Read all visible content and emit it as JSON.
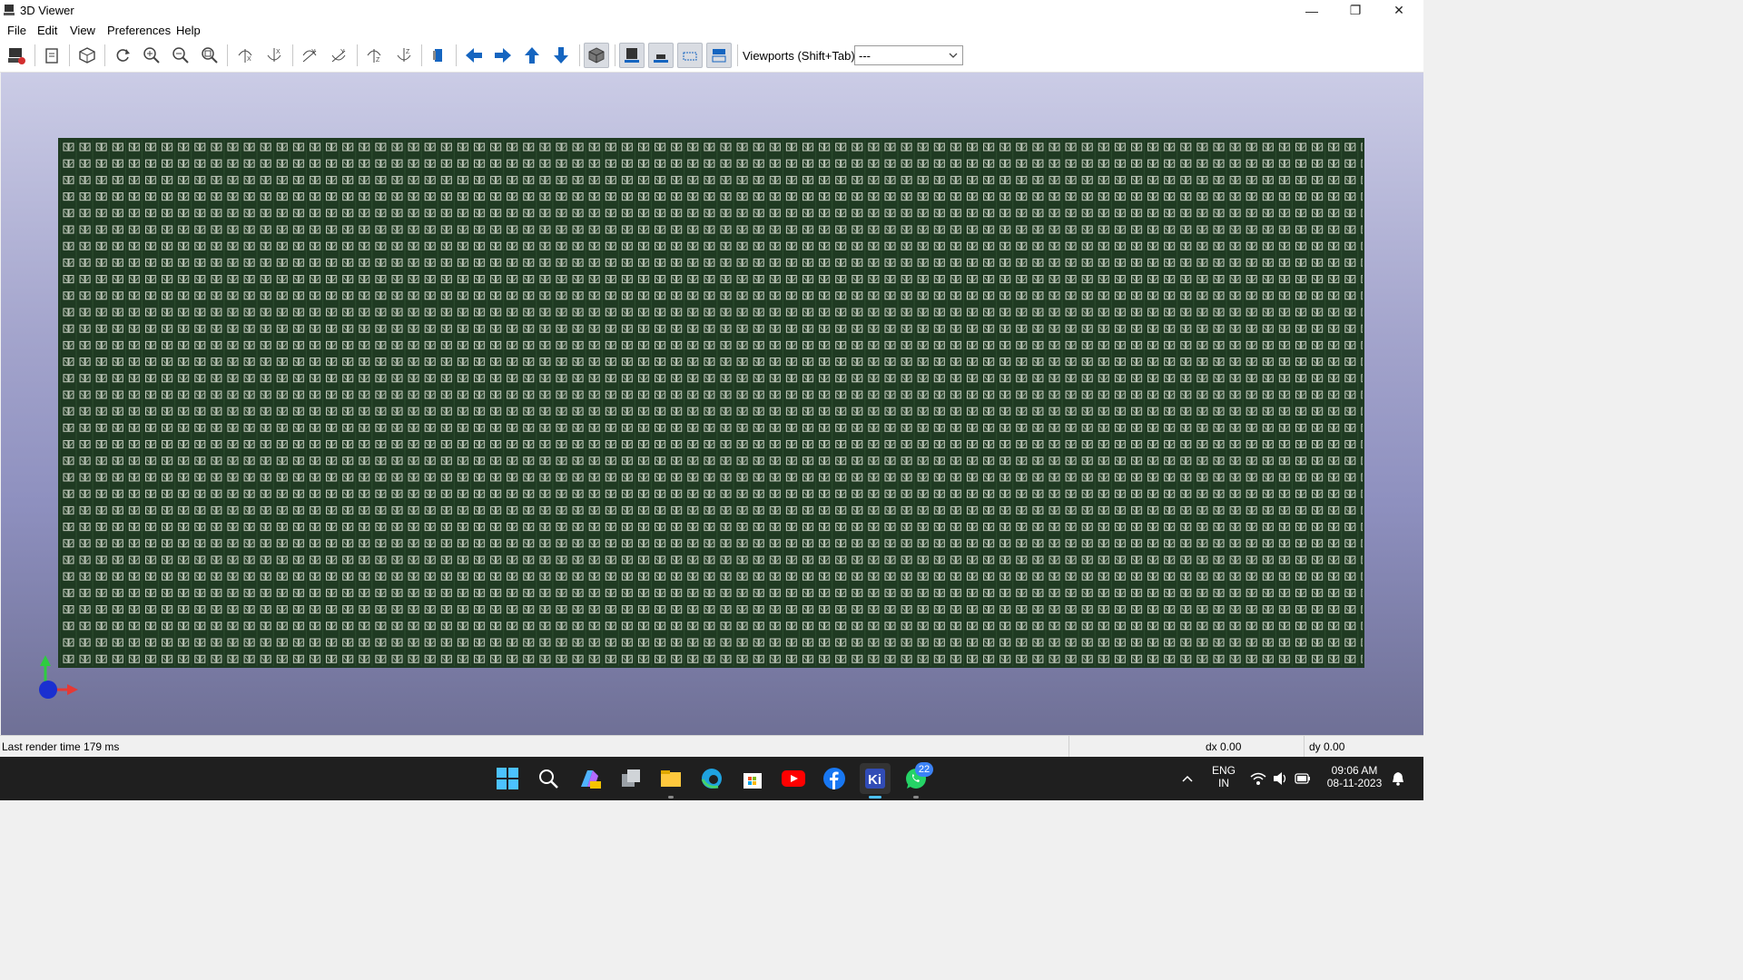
{
  "window": {
    "title": "3D Viewer",
    "minimize": "—",
    "restore": "❐",
    "close": "✕"
  },
  "menu": [
    "File",
    "Edit",
    "View",
    "Preferences",
    "Help"
  ],
  "toolbar": {
    "viewports_label": "Viewports (Shift+Tab):",
    "viewports_value": "---",
    "buttons": [
      "export-image-icon",
      "copy-to-clipboard-icon",
      "reload-board-icon",
      "redraw-icon",
      "zoom-in-icon",
      "zoom-out-icon",
      "zoom-fit-icon",
      "rotate-x-cw-icon",
      "rotate-x-ccw-icon",
      "rotate-y-cw-icon",
      "rotate-y-ccw-icon",
      "rotate-z-cw-icon",
      "rotate-z-ccw-icon",
      "flip-board-icon",
      "pan-left-icon",
      "pan-right-icon",
      "pan-up-icon",
      "pan-down-icon",
      "ortho-projection-icon",
      "show-tht-icon",
      "show-smd-icon",
      "show-virtual-icon",
      "show-not-in-pos-icon"
    ]
  },
  "status": {
    "render_time": "Last render time 179 ms",
    "dx": "dx 0.00",
    "dy": "dy 0.00"
  },
  "taskbar": {
    "apps": [
      "windows-start-icon",
      "search-icon",
      "photoshop-express-icon",
      "task-view-icon",
      "file-explorer-icon",
      "edge-browser-icon",
      "microsoft-store-icon",
      "youtube-icon",
      "facebook-icon",
      "kicad-icon",
      "whatsapp-icon"
    ],
    "whatsapp_badge": "22",
    "language_line1": "ENG",
    "language_line2": "IN",
    "time": "09:06 AM",
    "date": "08-11-2023"
  },
  "colors": {
    "board": "#1f3a22",
    "pad": "#cfd6c9",
    "accent": "#1565c0"
  }
}
